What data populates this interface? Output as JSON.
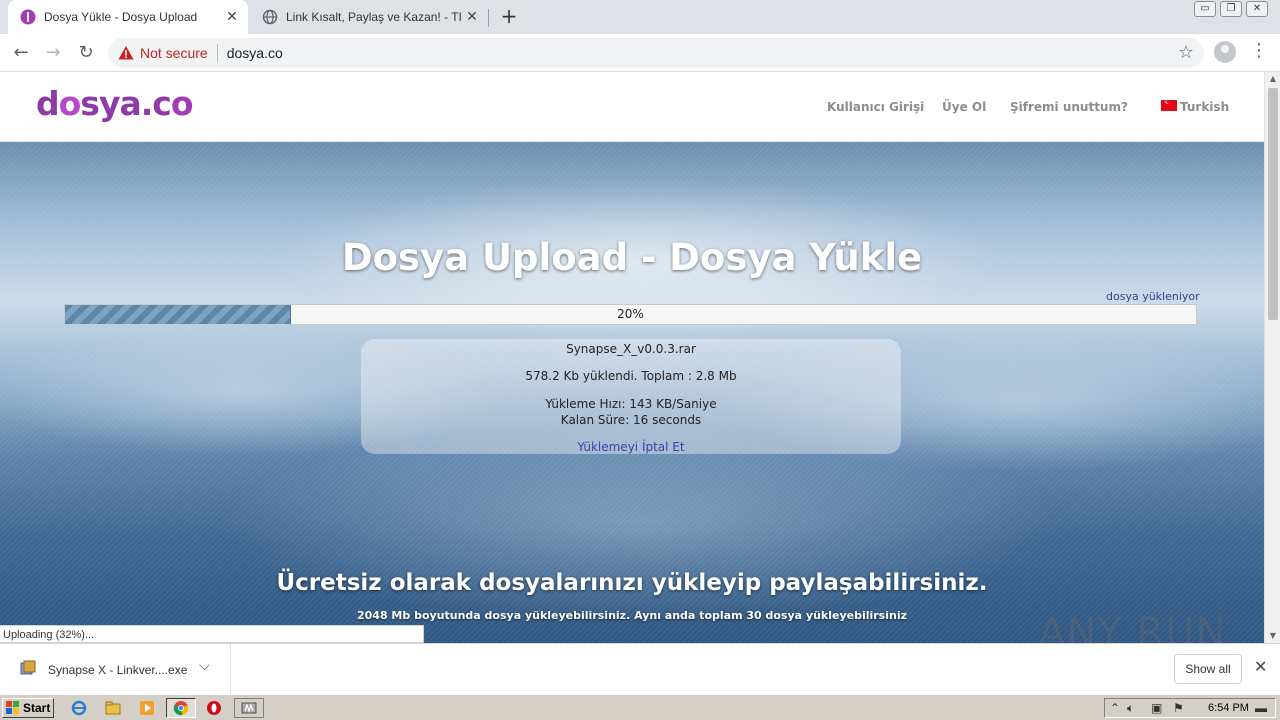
{
  "browser": {
    "tabs": [
      {
        "title": "Dosya Yükle - Dosya Upload",
        "close": "✕",
        "active": true
      },
      {
        "title": "Link Kısalt, Paylaş ve Kazan! - TIK.LA",
        "close": "✕",
        "active": false
      }
    ],
    "new_tab": "+",
    "window_buttons": {
      "minimize": "▭",
      "restore": "❐",
      "close": "✕"
    },
    "nav": {
      "back": "←",
      "forward": "→",
      "reload": "↻"
    },
    "security_label": "Not secure",
    "url": "dosya.co",
    "bookmark_star": "☆",
    "menu": "⋮"
  },
  "site": {
    "logo": {
      "d": "d",
      "o": "o",
      "sya": "sya.c",
      "o2": "o"
    },
    "nav": {
      "login": "Kullanıcı Girişi",
      "signup": "Üye Ol",
      "forgot": "Şifremi unuttum?",
      "language": "Turkish"
    },
    "hero_title": "Dosya Upload - Dosya Yükle",
    "uploading_label": "dosya yükleniyor",
    "progress": {
      "percent": 20,
      "label": "20%"
    },
    "upload_info": {
      "filename": "Synapse_X_v0.0.3.rar",
      "uploaded": "578.2 Kb yüklendi. Toplam : 2.8 Mb",
      "speed": "Yükleme Hızı: 143 KB/Saniye",
      "remaining": "Kalan Süre: 16 seconds",
      "cancel": "Yüklemeyi İptal Et"
    },
    "tagline": "Ücretsiz olarak dosyalarınızı yükleyip paylaşabilirsiniz.",
    "subtagline": "2048 Mb boyutunda dosya yükleyebilirsiniz. Aynı anda toplam 30 dosya yükleyebilirsiniz"
  },
  "status_bubble": "Uploading (32%)...",
  "watermark": "ANY RUN",
  "download_shelf": {
    "item_name": "Synapse X - Linkver....exe",
    "chevron": "⌵",
    "show_all": "Show all",
    "close": "✕"
  },
  "taskbar": {
    "start": "Start",
    "clock": "6:54 PM"
  },
  "colors": {
    "logo_purple": "#8e3ba5",
    "not_secure_red": "#c5221f",
    "cancel_link": "#3d3fae",
    "progress_fill": "#5d86ab"
  }
}
